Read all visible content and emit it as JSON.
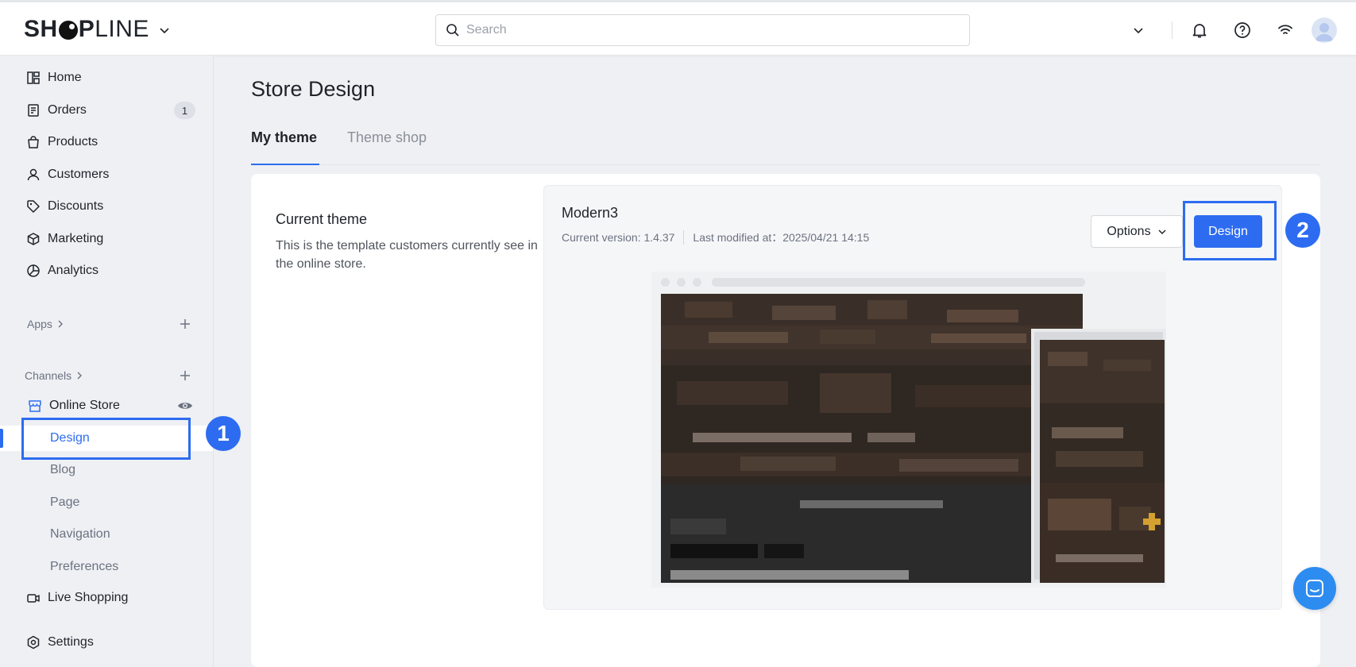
{
  "header": {
    "logo_bold": "SH",
    "logo_mid": "P",
    "logo_light": "LINE",
    "search_placeholder": "Search",
    "icons": [
      "chevron-down-icon",
      "bell-icon",
      "help-icon",
      "wifi-icon",
      "user-avatar"
    ]
  },
  "sidebar": {
    "main_items": [
      {
        "label": "Home",
        "icon": "home-icon"
      },
      {
        "label": "Orders",
        "icon": "orders-icon",
        "badge": "1"
      },
      {
        "label": "Products",
        "icon": "bag-icon"
      },
      {
        "label": "Customers",
        "icon": "person-icon"
      },
      {
        "label": "Discounts",
        "icon": "tag-icon"
      },
      {
        "label": "Marketing",
        "icon": "cube-icon"
      },
      {
        "label": "Analytics",
        "icon": "pie-chart-icon"
      }
    ],
    "apps_label": "Apps",
    "channels_label": "Channels",
    "online_store_label": "Online Store",
    "online_store_subitems": [
      "Design",
      "Blog",
      "Page",
      "Navigation",
      "Preferences"
    ],
    "active_subitem": "Design",
    "live_shopping_label": "Live Shopping",
    "settings_label": "Settings"
  },
  "main": {
    "page_title": "Store Design",
    "tabs": [
      {
        "label": "My theme",
        "active": true
      },
      {
        "label": "Theme shop",
        "active": false
      }
    ],
    "current_theme": {
      "title": "Current theme",
      "description": "This is the template customers currently see in the online store."
    },
    "theme": {
      "name": "Modern3",
      "version_text": "Current version: 1.4.37",
      "modified_text": "Last modified at：2025/04/21 14:15",
      "options_label": "Options",
      "design_label": "Design"
    }
  },
  "annotations": {
    "step1": "1",
    "step2": "2"
  },
  "colors": {
    "accent": "#2d6cf0",
    "sidebar_bg": "#eef0f4",
    "chat_button": "#2d8cf0"
  }
}
